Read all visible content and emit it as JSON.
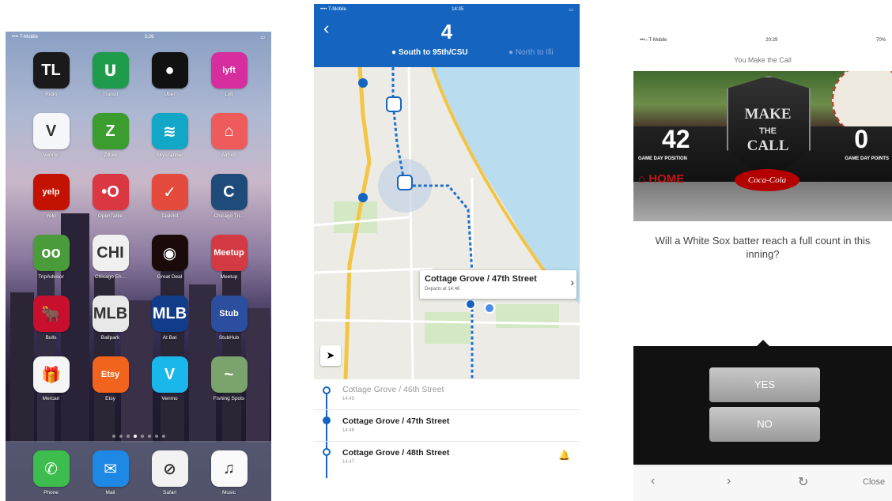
{
  "phone1": {
    "status": {
      "carrier": "•••• T-Mobile",
      "time": "3:26"
    },
    "apps": [
      {
        "label": "Ridin",
        "icon": "rideshare-icon",
        "glyph": "TL",
        "color": "#1a1a1a"
      },
      {
        "label": "Transit",
        "icon": "transit-icon",
        "glyph": "ᑌ",
        "color": "#1f9c4b"
      },
      {
        "label": "Uber",
        "icon": "uber-icon",
        "glyph": "●",
        "color": "#111111"
      },
      {
        "label": "Lyft",
        "icon": "lyft-icon",
        "glyph": "lyft",
        "color": "#d62e9e"
      },
      {
        "label": "Venmo",
        "icon": "venmo-icon",
        "glyph": "V",
        "color": "#f5f7fa"
      },
      {
        "label": "Zillow",
        "icon": "zillow-icon",
        "glyph": "Z",
        "color": "#3a9d2e"
      },
      {
        "label": "Skyscanner",
        "icon": "skyscanner-icon",
        "glyph": "≋",
        "color": "#12a7c7"
      },
      {
        "label": "Airbnb",
        "icon": "airbnb-icon",
        "glyph": "⌂",
        "color": "#ef5b5b"
      },
      {
        "label": "Yelp",
        "icon": "yelp-icon",
        "glyph": "yelp",
        "color": "#c41200"
      },
      {
        "label": "OpenTable",
        "icon": "opentable-icon",
        "glyph": "•O",
        "color": "#da3743"
      },
      {
        "label": "Tasklist",
        "icon": "tasks-icon",
        "glyph": "✓",
        "color": "#e54b3c"
      },
      {
        "label": "Chicago Tri...",
        "icon": "tribune-icon",
        "glyph": "C",
        "color": "#1f4b7a"
      },
      {
        "label": "TripAdvisor",
        "icon": "tripadvisor-icon",
        "glyph": "oo",
        "color": "#4a9c3b"
      },
      {
        "label": "Chicago Eh...",
        "icon": "chicago-icon",
        "glyph": "CHI",
        "color": "#f0f0f0"
      },
      {
        "label": "Great Deal",
        "icon": "deal-icon",
        "glyph": "◉",
        "color": "#1a0a0a"
      },
      {
        "label": "Meetup",
        "icon": "meetup-icon",
        "glyph": "Meetup",
        "color": "#d33a43"
      },
      {
        "label": "Bulls",
        "icon": "bulls-icon",
        "glyph": "🐂",
        "color": "#c8102e"
      },
      {
        "label": "Ballpark",
        "icon": "ballpark-icon",
        "glyph": "MLB",
        "color": "#e8e8e8"
      },
      {
        "label": "At Bat",
        "icon": "mlb-icon",
        "glyph": "MLB",
        "color": "#113c8a"
      },
      {
        "label": "StubHub",
        "icon": "stubhub-icon",
        "glyph": "Stub",
        "color": "#2b4f9e"
      },
      {
        "label": "Mercari",
        "icon": "mercari-icon",
        "glyph": "🎁",
        "color": "#f5f5f5"
      },
      {
        "label": "Etsy",
        "icon": "etsy-icon",
        "glyph": "Etsy",
        "color": "#f1641e"
      },
      {
        "label": "Venmo",
        "icon": "vimeo-icon",
        "glyph": "V",
        "color": "#1ab7ea"
      },
      {
        "label": "Fishing Spots",
        "icon": "fishing-icon",
        "glyph": "~",
        "color": "#7aa36d"
      }
    ],
    "dock": [
      {
        "label": "Phone",
        "icon": "phone-icon",
        "glyph": "✆",
        "color": "#3dbd4d"
      },
      {
        "label": "Mail",
        "icon": "mail-icon",
        "glyph": "✉",
        "color": "#1e88e5"
      },
      {
        "label": "Safari",
        "icon": "safari-icon",
        "glyph": "⊘",
        "color": "#f2f2f2"
      },
      {
        "label": "Music",
        "icon": "music-icon",
        "glyph": "♫",
        "color": "#fafafa"
      }
    ]
  },
  "phone2": {
    "status": {
      "carrier": "•••• T-Mobile",
      "time": "14:35"
    },
    "route": "4",
    "dir_active": "● South to 95th/CSU",
    "dir_inactive": "● North to Illi",
    "callout_title": "Cottage Grove / 47th Street",
    "callout_sub": "Departs at 14:46",
    "stops": [
      {
        "name": "Cottage Grove / 46th Street",
        "time": "14:45"
      },
      {
        "name": "Cottage Grove / 47th Street",
        "time": "14:46"
      },
      {
        "name": "Cottage Grove / 48th Street",
        "time": "14:47"
      }
    ]
  },
  "phone3": {
    "status": {
      "carrier": "•••○ T-Mobile",
      "time": "20:29",
      "battery": "70%"
    },
    "title": "You Make the Call",
    "position": "42",
    "position_caption": "GAME DAY POSITION",
    "points": "0",
    "points_caption": "GAME DAY POINTS",
    "logo_make": "MAKE",
    "logo_the": "THE",
    "logo_call": "CALL",
    "sponsor": "Coca-Cola",
    "home": "HOME",
    "question": "Will a White Sox batter reach a full count in this inning?",
    "yes": "YES",
    "no": "NO",
    "close": "Close"
  }
}
